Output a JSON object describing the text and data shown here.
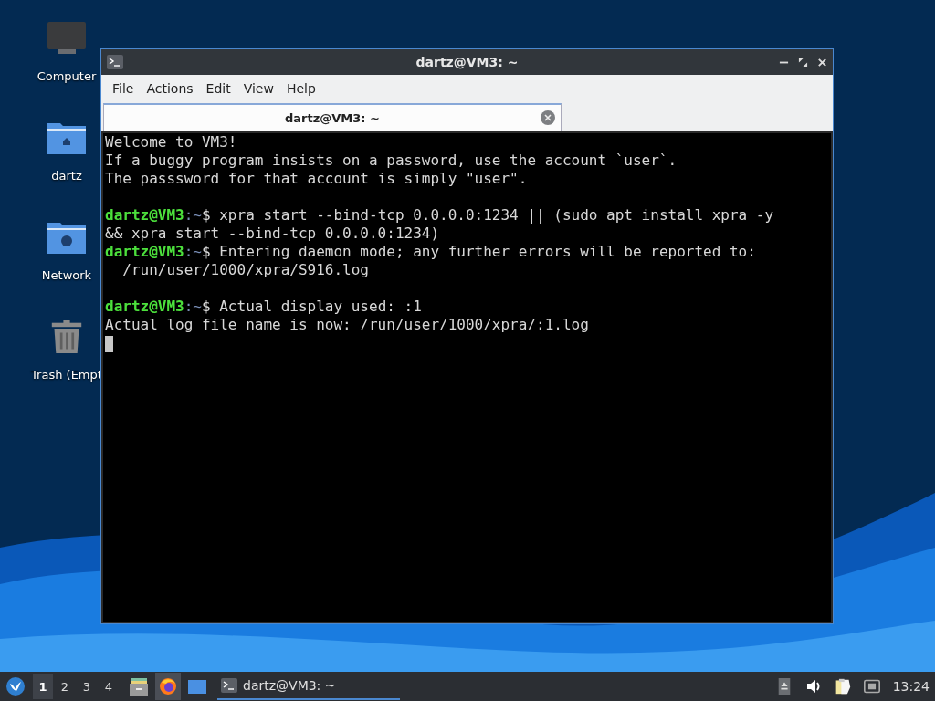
{
  "desktop_icons": [
    {
      "kind": "computer",
      "label": "Computer"
    },
    {
      "kind": "home_folder",
      "label": "dartz"
    },
    {
      "kind": "network_folder",
      "label": "Network"
    },
    {
      "kind": "trash",
      "label": "Trash (Empt"
    }
  ],
  "window": {
    "title": "dartz@VM3: ~",
    "menu": [
      "File",
      "Actions",
      "Edit",
      "View",
      "Help"
    ],
    "tabs": [
      {
        "label": "dartz@VM3: ~",
        "selected": true
      }
    ],
    "terminal_lines": [
      {
        "kind": "text",
        "segments": [
          {
            "kind": "plain",
            "text": "Welcome to VM3!"
          }
        ]
      },
      {
        "kind": "text",
        "segments": [
          {
            "kind": "plain",
            "text": "If a buggy program insists on a password, use the account `user`."
          }
        ]
      },
      {
        "kind": "text",
        "segments": [
          {
            "kind": "plain",
            "text": "The passsword for that account is simply \"user\"."
          }
        ]
      },
      {
        "kind": "blank"
      },
      {
        "kind": "text",
        "segments": [
          {
            "kind": "user",
            "text": "dartz@VM3"
          },
          {
            "kind": "path",
            "text": ":~"
          },
          {
            "kind": "plain",
            "text": "$ xpra start --bind-tcp 0.0.0.0:1234 || (sudo apt install xpra -y"
          }
        ]
      },
      {
        "kind": "text",
        "segments": [
          {
            "kind": "plain",
            "text": "&& xpra start --bind-tcp 0.0.0.0:1234)"
          }
        ]
      },
      {
        "kind": "text",
        "segments": [
          {
            "kind": "user",
            "text": "dartz@VM3"
          },
          {
            "kind": "path",
            "text": ":~"
          },
          {
            "kind": "plain",
            "text": "$ Entering daemon mode; any further errors will be reported to:"
          }
        ]
      },
      {
        "kind": "text",
        "segments": [
          {
            "kind": "plain",
            "text": "  /run/user/1000/xpra/S916.log"
          }
        ]
      },
      {
        "kind": "blank"
      },
      {
        "kind": "text",
        "segments": [
          {
            "kind": "user",
            "text": "dartz@VM3"
          },
          {
            "kind": "path",
            "text": ":~"
          },
          {
            "kind": "plain",
            "text": "$ Actual display used: :1"
          }
        ]
      },
      {
        "kind": "text",
        "segments": [
          {
            "kind": "plain",
            "text": "Actual log file name is now: /run/user/1000/xpra/:1.log"
          }
        ]
      },
      {
        "kind": "cursor"
      }
    ]
  },
  "taskbar": {
    "workspaces": [
      {
        "label": "1",
        "selected": true
      },
      {
        "label": "2",
        "selected": false
      },
      {
        "label": "3",
        "selected": false
      },
      {
        "label": "4",
        "selected": false
      }
    ],
    "launchers": [
      {
        "kind": "files",
        "selected": false
      },
      {
        "kind": "firefox",
        "selected": true
      },
      {
        "kind": "desktop",
        "selected": false
      }
    ],
    "tasks": [
      {
        "label": "dartz@VM3: ~",
        "selected": true
      }
    ],
    "clock": "13:24"
  }
}
